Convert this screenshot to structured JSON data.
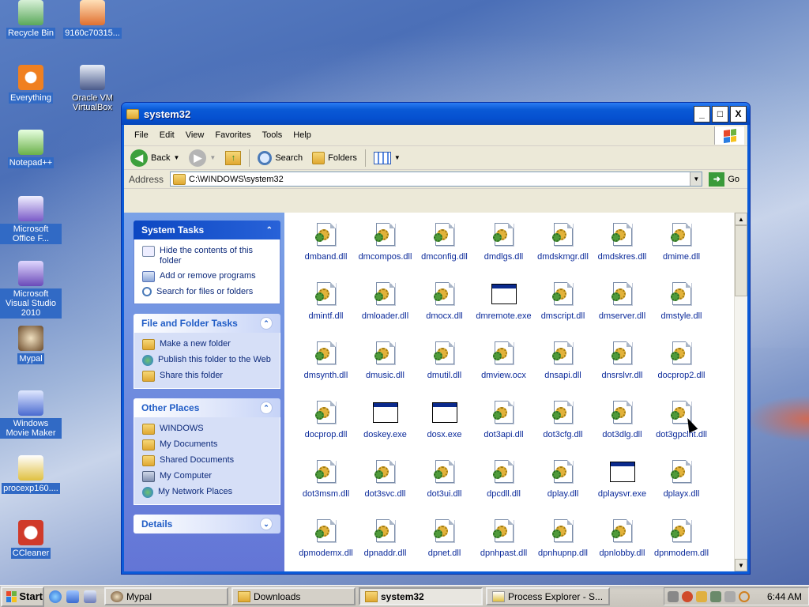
{
  "desktop": {
    "icons": [
      {
        "label": "Recycle Bin",
        "icon": "recycle-bin-icon",
        "selected": true
      },
      {
        "label": "9160c70315...",
        "icon": "archive-file-icon",
        "selected": true
      },
      {
        "label": "Everything",
        "icon": "everything-search-icon",
        "selected": true
      },
      {
        "label": "Oracle VM VirtualBox",
        "icon": "virtualbox-icon",
        "selected": false
      },
      {
        "label": "Notepad++",
        "icon": "notepad-plus-plus-icon",
        "selected": true
      },
      {
        "label": "Microsoft Office F...",
        "icon": "office-icon",
        "selected": true
      },
      {
        "label": "Microsoft Visual Studio 2010",
        "icon": "visual-studio-icon",
        "selected": true
      },
      {
        "label": "Mypal",
        "icon": "mypal-browser-icon",
        "selected": true
      },
      {
        "label": "Windows Movie Maker",
        "icon": "movie-maker-icon",
        "selected": true
      },
      {
        "label": "procexp160....",
        "icon": "process-explorer-icon",
        "selected": true
      },
      {
        "label": "CCleaner",
        "icon": "ccleaner-icon",
        "selected": true
      }
    ]
  },
  "window": {
    "title": "system32",
    "controls": {
      "minimize": "_",
      "maximize": "□",
      "close": "X"
    },
    "menu": [
      "File",
      "Edit",
      "View",
      "Favorites",
      "Tools",
      "Help"
    ],
    "toolbar": {
      "back": "Back",
      "search": "Search",
      "folders": "Folders"
    },
    "address": {
      "label": "Address",
      "value": "C:\\WINDOWS\\system32",
      "go": "Go"
    },
    "tasks": {
      "system": {
        "title": "System Tasks",
        "items": [
          "Hide the contents of this folder",
          "Add or remove programs",
          "Search for files or folders"
        ]
      },
      "file_folder": {
        "title": "File and Folder Tasks",
        "items": [
          "Make a new folder",
          "Publish this folder to the Web",
          "Share this folder"
        ]
      },
      "other_places": {
        "title": "Other Places",
        "items": [
          "WINDOWS",
          "My Documents",
          "Shared Documents",
          "My Computer",
          "My Network Places"
        ]
      },
      "details": {
        "title": "Details"
      }
    },
    "files": [
      {
        "name": "dmband.dll",
        "type": "dll"
      },
      {
        "name": "dmcompos.dll",
        "type": "dll"
      },
      {
        "name": "dmconfig.dll",
        "type": "dll"
      },
      {
        "name": "dmdlgs.dll",
        "type": "dll"
      },
      {
        "name": "dmdskmgr.dll",
        "type": "dll"
      },
      {
        "name": "dmdskres.dll",
        "type": "dll"
      },
      {
        "name": "dmime.dll",
        "type": "dll"
      },
      {
        "name": "dmintf.dll",
        "type": "dll"
      },
      {
        "name": "dmloader.dll",
        "type": "dll"
      },
      {
        "name": "dmocx.dll",
        "type": "dll"
      },
      {
        "name": "dmremote.exe",
        "type": "exe"
      },
      {
        "name": "dmscript.dll",
        "type": "dll"
      },
      {
        "name": "dmserver.dll",
        "type": "dll"
      },
      {
        "name": "dmstyle.dll",
        "type": "dll"
      },
      {
        "name": "dmsynth.dll",
        "type": "dll"
      },
      {
        "name": "dmusic.dll",
        "type": "dll"
      },
      {
        "name": "dmutil.dll",
        "type": "dll"
      },
      {
        "name": "dmview.ocx",
        "type": "dll"
      },
      {
        "name": "dnsapi.dll",
        "type": "dll"
      },
      {
        "name": "dnsrslvr.dll",
        "type": "dll"
      },
      {
        "name": "docprop2.dll",
        "type": "dll"
      },
      {
        "name": "docprop.dll",
        "type": "dll"
      },
      {
        "name": "doskey.exe",
        "type": "exe"
      },
      {
        "name": "dosx.exe",
        "type": "exe"
      },
      {
        "name": "dot3api.dll",
        "type": "dll"
      },
      {
        "name": "dot3cfg.dll",
        "type": "dll"
      },
      {
        "name": "dot3dlg.dll",
        "type": "dll"
      },
      {
        "name": "dot3gpclnt.dll",
        "type": "dll"
      },
      {
        "name": "dot3msm.dll",
        "type": "dll"
      },
      {
        "name": "dot3svc.dll",
        "type": "dll"
      },
      {
        "name": "dot3ui.dll",
        "type": "dll"
      },
      {
        "name": "dpcdll.dll",
        "type": "dll"
      },
      {
        "name": "dplay.dll",
        "type": "dll"
      },
      {
        "name": "dplaysvr.exe",
        "type": "exe"
      },
      {
        "name": "dplayx.dll",
        "type": "dll"
      },
      {
        "name": "dpmodemx.dll",
        "type": "dll"
      },
      {
        "name": "dpnaddr.dll",
        "type": "dll"
      },
      {
        "name": "dpnet.dll",
        "type": "dll"
      },
      {
        "name": "dpnhpast.dll",
        "type": "dll"
      },
      {
        "name": "dpnhupnp.dll",
        "type": "dll"
      },
      {
        "name": "dpnlobby.dll",
        "type": "dll"
      },
      {
        "name": "dpnmodem.dll",
        "type": "dll"
      }
    ]
  },
  "taskbar": {
    "start": "Start",
    "tasks": [
      {
        "label": "Mypal",
        "icon": "mypal-browser-icon",
        "active": false
      },
      {
        "label": "Downloads",
        "icon": "folder-icon",
        "active": false
      },
      {
        "label": "system32",
        "icon": "folder-icon",
        "active": true
      },
      {
        "label": "Process Explorer - S...",
        "icon": "process-explorer-icon",
        "active": false
      }
    ],
    "clock": "6:44 AM"
  }
}
